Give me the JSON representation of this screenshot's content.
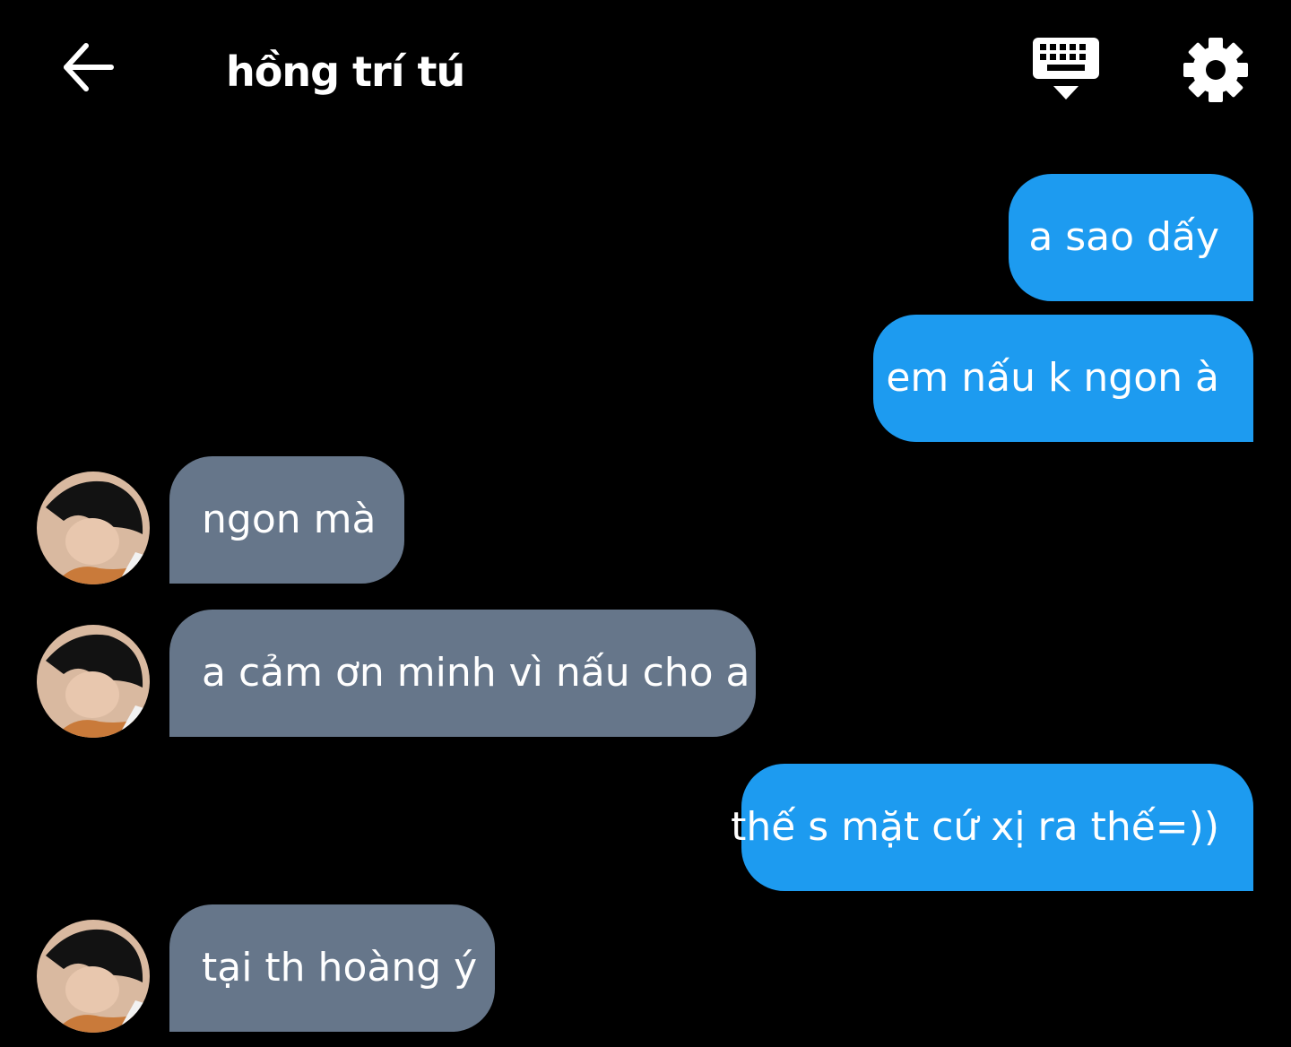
{
  "header": {
    "title": "hồng trí tú",
    "back_icon": "arrow-left-icon",
    "keyboard_icon": "keyboard-hide-icon",
    "settings_icon": "gear-icon"
  },
  "colors": {
    "background": "#000000",
    "sent_bubble": "#1d9bf0",
    "received_bubble": "#66768a",
    "text": "#ffffff"
  },
  "messages": [
    {
      "sender": "me",
      "text": "a sao dấy"
    },
    {
      "sender": "me",
      "text": "em nấu k ngon à"
    },
    {
      "sender": "other",
      "text": "ngon mà"
    },
    {
      "sender": "other",
      "text": "a cảm ơn minh vì nấu cho a"
    },
    {
      "sender": "me",
      "text": "thế s mặt cứ xị ra thế=))"
    },
    {
      "sender": "other",
      "text": "tại th hoàng ý"
    }
  ]
}
